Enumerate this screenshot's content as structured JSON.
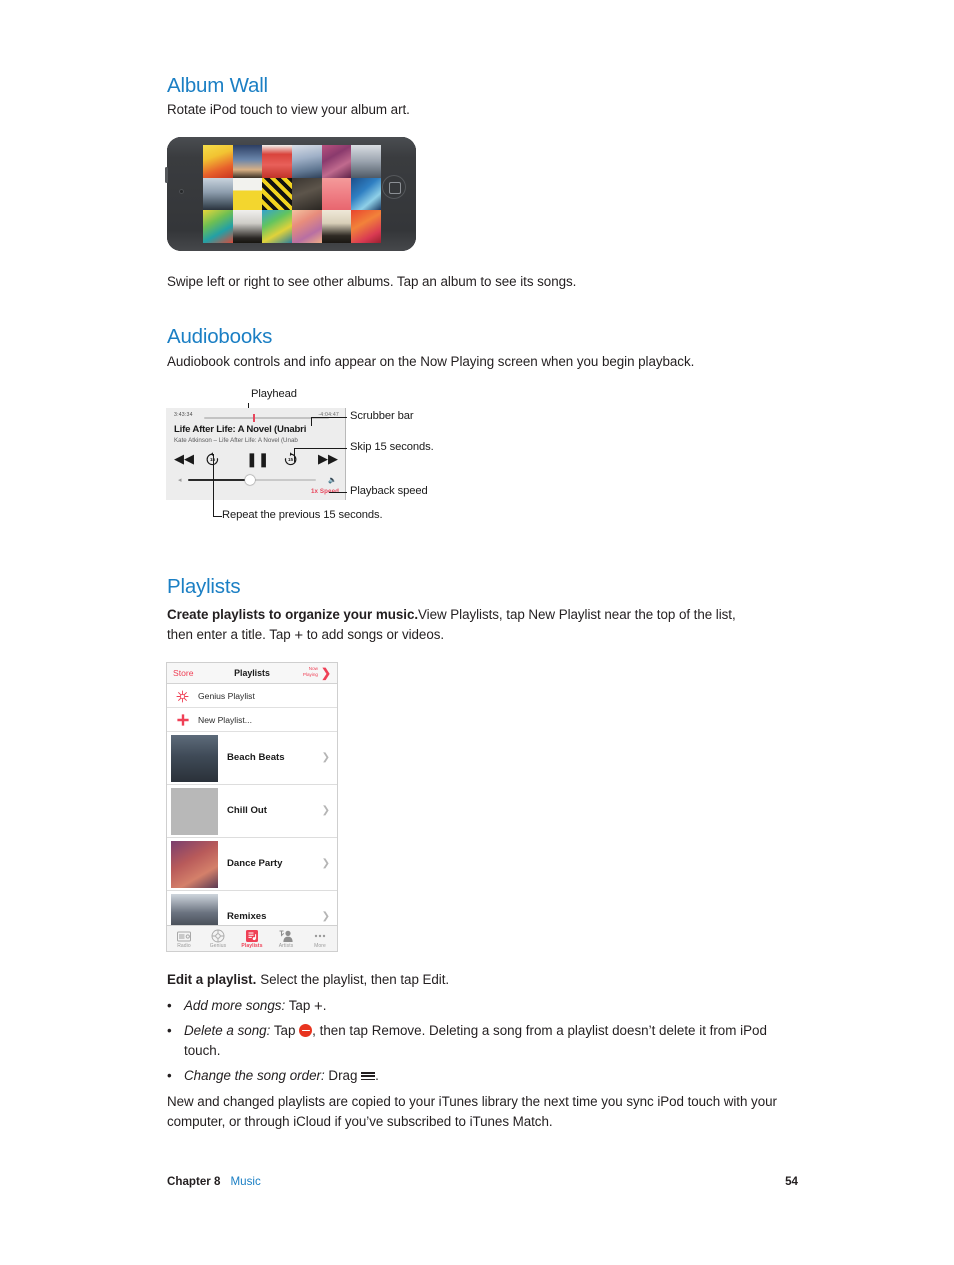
{
  "sections": {
    "album_wall": {
      "heading": "Album Wall",
      "intro": "Rotate iPod touch to view your album art.",
      "caption": "Swipe left or right to see other albums. Tap an album to see its songs."
    },
    "audiobooks": {
      "heading": "Audiobooks",
      "intro": "Audiobook controls and info appear on the Now Playing screen when you begin playback.",
      "callouts": {
        "playhead": "Playhead",
        "scrubber_bar": "Scrubber bar",
        "skip_15": "Skip 15 seconds.",
        "playback_speed": "Playback speed",
        "repeat_15": "Repeat the previous 15 seconds."
      },
      "player": {
        "elapsed": "3:43:34",
        "remaining": "-4:04:47",
        "title": "Life After Life: A Novel (Unabri",
        "subtitle": "Kate Atkinson – Life After Life: A Novel (Unab",
        "skip_back_label": "15",
        "skip_forward_label": "15",
        "speed": "1x Speed"
      }
    },
    "playlists": {
      "heading": "Playlists",
      "create": {
        "lead": "Create playlists to organize your music.",
        "rest_1": "View Playlists, tap New Playlist near the top of the list,",
        "rest_2": "then enter a title. Tap ",
        "rest_3": " to add songs or videos."
      },
      "edit": {
        "lead": "Edit a playlist.",
        "rest": "Select the playlist, then tap Edit."
      },
      "bullets": [
        {
          "term": "Add more songs:",
          "text_before": " Tap ",
          "icon": "plus-icon",
          "text_after": "."
        },
        {
          "term": "Delete a song:",
          "text_before": " Tap ",
          "icon": "minus-circle-icon",
          "text_after": ", then tap Remove. Deleting a song from a playlist doesn’t delete it from iPod touch."
        },
        {
          "term": "Change the song order:",
          "text_before": " Drag ",
          "icon": "reorder-bars-icon",
          "text_after": "."
        }
      ],
      "closing": "New and changed playlists are copied to your iTunes library the next time you sync iPod touch with your computer, or through iCloud if you’ve subscribed to iTunes Match.",
      "mockup": {
        "nav": {
          "left": "Store",
          "title": "Playlists",
          "right_line1": "Now",
          "right_line2": "Playing",
          "chevron": "❯"
        },
        "rows": [
          {
            "icon": "genius-icon",
            "label": "Genius Playlist"
          },
          {
            "icon": "plus-icon",
            "label": "New Playlist..."
          }
        ],
        "items": [
          {
            "name": "Beach Beats",
            "chevron": "❯"
          },
          {
            "name": "Chill Out",
            "chevron": "❯"
          },
          {
            "name": "Dance Party",
            "chevron": "❯"
          },
          {
            "name": "Remixes",
            "chevron": "❯"
          }
        ],
        "tabs": [
          {
            "label": "Radio",
            "icon": "radio-icon",
            "active": false
          },
          {
            "label": "Genius",
            "icon": "genius-icon",
            "active": false
          },
          {
            "label": "Playlists",
            "icon": "playlists-icon",
            "active": true
          },
          {
            "label": "Artists",
            "icon": "artists-icon",
            "active": false
          },
          {
            "label": "More",
            "icon": "more-icon",
            "active": false
          }
        ]
      }
    }
  },
  "footer": {
    "chapter": "Chapter  8",
    "module": "Music",
    "page_number": "54"
  },
  "colors": {
    "heading_blue": "#1b7fc4",
    "link_blue": "#1b7fc4",
    "accent_red": "#ef4056",
    "playhead_red": "#e8465c",
    "minus_red": "#e8341f",
    "text": "#231f20"
  }
}
